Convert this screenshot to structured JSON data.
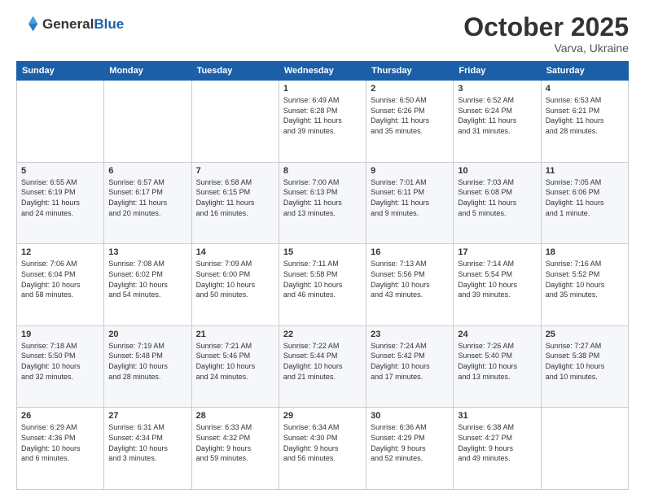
{
  "header": {
    "logo_line1": "General",
    "logo_line2": "Blue",
    "month": "October 2025",
    "location": "Varva, Ukraine"
  },
  "days_of_week": [
    "Sunday",
    "Monday",
    "Tuesday",
    "Wednesday",
    "Thursday",
    "Friday",
    "Saturday"
  ],
  "weeks": [
    [
      {
        "day": "",
        "info": ""
      },
      {
        "day": "",
        "info": ""
      },
      {
        "day": "",
        "info": ""
      },
      {
        "day": "1",
        "info": "Sunrise: 6:49 AM\nSunset: 6:28 PM\nDaylight: 11 hours\nand 39 minutes."
      },
      {
        "day": "2",
        "info": "Sunrise: 6:50 AM\nSunset: 6:26 PM\nDaylight: 11 hours\nand 35 minutes."
      },
      {
        "day": "3",
        "info": "Sunrise: 6:52 AM\nSunset: 6:24 PM\nDaylight: 11 hours\nand 31 minutes."
      },
      {
        "day": "4",
        "info": "Sunrise: 6:53 AM\nSunset: 6:21 PM\nDaylight: 11 hours\nand 28 minutes."
      }
    ],
    [
      {
        "day": "5",
        "info": "Sunrise: 6:55 AM\nSunset: 6:19 PM\nDaylight: 11 hours\nand 24 minutes."
      },
      {
        "day": "6",
        "info": "Sunrise: 6:57 AM\nSunset: 6:17 PM\nDaylight: 11 hours\nand 20 minutes."
      },
      {
        "day": "7",
        "info": "Sunrise: 6:58 AM\nSunset: 6:15 PM\nDaylight: 11 hours\nand 16 minutes."
      },
      {
        "day": "8",
        "info": "Sunrise: 7:00 AM\nSunset: 6:13 PM\nDaylight: 11 hours\nand 13 minutes."
      },
      {
        "day": "9",
        "info": "Sunrise: 7:01 AM\nSunset: 6:11 PM\nDaylight: 11 hours\nand 9 minutes."
      },
      {
        "day": "10",
        "info": "Sunrise: 7:03 AM\nSunset: 6:08 PM\nDaylight: 11 hours\nand 5 minutes."
      },
      {
        "day": "11",
        "info": "Sunrise: 7:05 AM\nSunset: 6:06 PM\nDaylight: 11 hours\nand 1 minute."
      }
    ],
    [
      {
        "day": "12",
        "info": "Sunrise: 7:06 AM\nSunset: 6:04 PM\nDaylight: 10 hours\nand 58 minutes."
      },
      {
        "day": "13",
        "info": "Sunrise: 7:08 AM\nSunset: 6:02 PM\nDaylight: 10 hours\nand 54 minutes."
      },
      {
        "day": "14",
        "info": "Sunrise: 7:09 AM\nSunset: 6:00 PM\nDaylight: 10 hours\nand 50 minutes."
      },
      {
        "day": "15",
        "info": "Sunrise: 7:11 AM\nSunset: 5:58 PM\nDaylight: 10 hours\nand 46 minutes."
      },
      {
        "day": "16",
        "info": "Sunrise: 7:13 AM\nSunset: 5:56 PM\nDaylight: 10 hours\nand 43 minutes."
      },
      {
        "day": "17",
        "info": "Sunrise: 7:14 AM\nSunset: 5:54 PM\nDaylight: 10 hours\nand 39 minutes."
      },
      {
        "day": "18",
        "info": "Sunrise: 7:16 AM\nSunset: 5:52 PM\nDaylight: 10 hours\nand 35 minutes."
      }
    ],
    [
      {
        "day": "19",
        "info": "Sunrise: 7:18 AM\nSunset: 5:50 PM\nDaylight: 10 hours\nand 32 minutes."
      },
      {
        "day": "20",
        "info": "Sunrise: 7:19 AM\nSunset: 5:48 PM\nDaylight: 10 hours\nand 28 minutes."
      },
      {
        "day": "21",
        "info": "Sunrise: 7:21 AM\nSunset: 5:46 PM\nDaylight: 10 hours\nand 24 minutes."
      },
      {
        "day": "22",
        "info": "Sunrise: 7:22 AM\nSunset: 5:44 PM\nDaylight: 10 hours\nand 21 minutes."
      },
      {
        "day": "23",
        "info": "Sunrise: 7:24 AM\nSunset: 5:42 PM\nDaylight: 10 hours\nand 17 minutes."
      },
      {
        "day": "24",
        "info": "Sunrise: 7:26 AM\nSunset: 5:40 PM\nDaylight: 10 hours\nand 13 minutes."
      },
      {
        "day": "25",
        "info": "Sunrise: 7:27 AM\nSunset: 5:38 PM\nDaylight: 10 hours\nand 10 minutes."
      }
    ],
    [
      {
        "day": "26",
        "info": "Sunrise: 6:29 AM\nSunset: 4:36 PM\nDaylight: 10 hours\nand 6 minutes."
      },
      {
        "day": "27",
        "info": "Sunrise: 6:31 AM\nSunset: 4:34 PM\nDaylight: 10 hours\nand 3 minutes."
      },
      {
        "day": "28",
        "info": "Sunrise: 6:33 AM\nSunset: 4:32 PM\nDaylight: 9 hours\nand 59 minutes."
      },
      {
        "day": "29",
        "info": "Sunrise: 6:34 AM\nSunset: 4:30 PM\nDaylight: 9 hours\nand 56 minutes."
      },
      {
        "day": "30",
        "info": "Sunrise: 6:36 AM\nSunset: 4:29 PM\nDaylight: 9 hours\nand 52 minutes."
      },
      {
        "day": "31",
        "info": "Sunrise: 6:38 AM\nSunset: 4:27 PM\nDaylight: 9 hours\nand 49 minutes."
      },
      {
        "day": "",
        "info": ""
      }
    ]
  ]
}
